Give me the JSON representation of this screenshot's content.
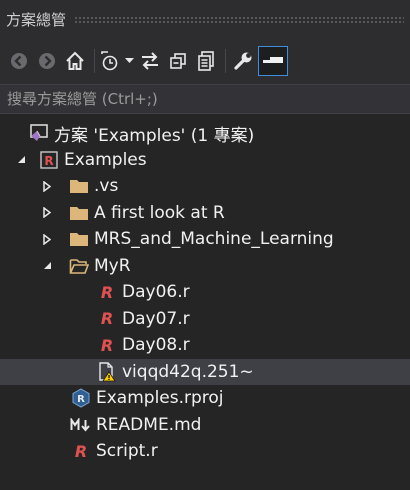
{
  "window": {
    "title": "方案總管"
  },
  "search": {
    "placeholder": "搜尋方案總管 (Ctrl+;)"
  },
  "toolbar": {
    "buttons": [
      "back-icon",
      "forward-icon",
      "home-icon",
      "pending-changes-filter-icon",
      "dropdown-arrow-icon",
      "sync-icon",
      "collapse-all-icon",
      "show-all-files-icon",
      "properties-icon",
      "preview-icon"
    ]
  },
  "tree": {
    "solution": "方案 'Examples' (1 專案)",
    "project": "Examples",
    "folders": {
      "vs": ".vs",
      "first_look": "A first look at R",
      "mrs": "MRS_and_Machine_Learning",
      "myr": "MyR"
    },
    "myr_files": [
      "Day06.r",
      "Day07.r",
      "Day08.r",
      "viqqd42q.251~"
    ],
    "root_files": [
      "Examples.rproj",
      "README.md",
      "Script.r"
    ]
  },
  "colors": {
    "accent": "#3e8ede",
    "r_red": "#e05252",
    "folder": "#dcb67a",
    "warning": "#ffcc00"
  }
}
